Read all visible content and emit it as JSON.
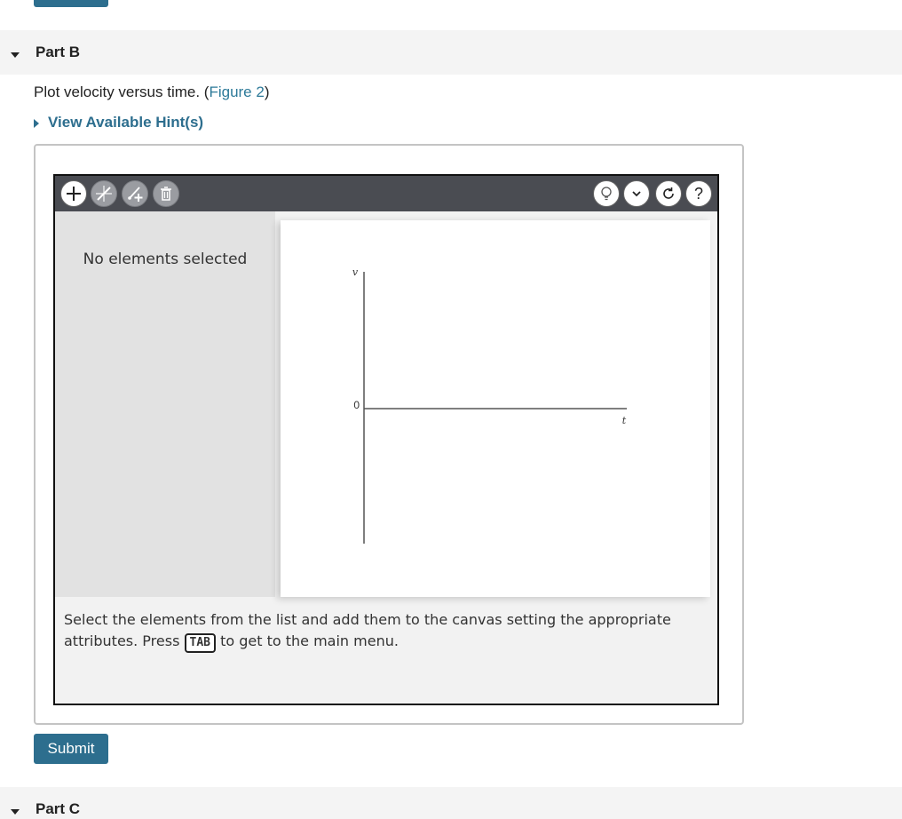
{
  "part_b": {
    "title": "Part B"
  },
  "part_c": {
    "title": "Part C"
  },
  "question": {
    "text_before": "Plot velocity versus time. (",
    "figure_link": "Figure 2",
    "text_after": ")"
  },
  "hint": {
    "label": "View Available Hint(s)"
  },
  "toolbar": {
    "left_icons": [
      "add-icon",
      "line-tool-icon",
      "add-point-icon",
      "trash-icon"
    ],
    "right_icons": [
      "lightbulb-icon",
      "chevron-down-icon",
      "reset-icon",
      "help-icon"
    ]
  },
  "sidepanel": {
    "message": "No elements selected"
  },
  "graph": {
    "y_axis_label": "v",
    "x_axis_label": "t",
    "origin_label": "0"
  },
  "instructions": {
    "text_before": "Select the elements from the list and add them to the canvas setting the appropriate attributes. Press ",
    "key": "TAB",
    "text_after": " to get to the main menu."
  },
  "submit": {
    "label": "Submit"
  },
  "colors": {
    "primary": "#2d6e8e",
    "link": "#2d7a99",
    "toolbar": "#4a4c52"
  }
}
